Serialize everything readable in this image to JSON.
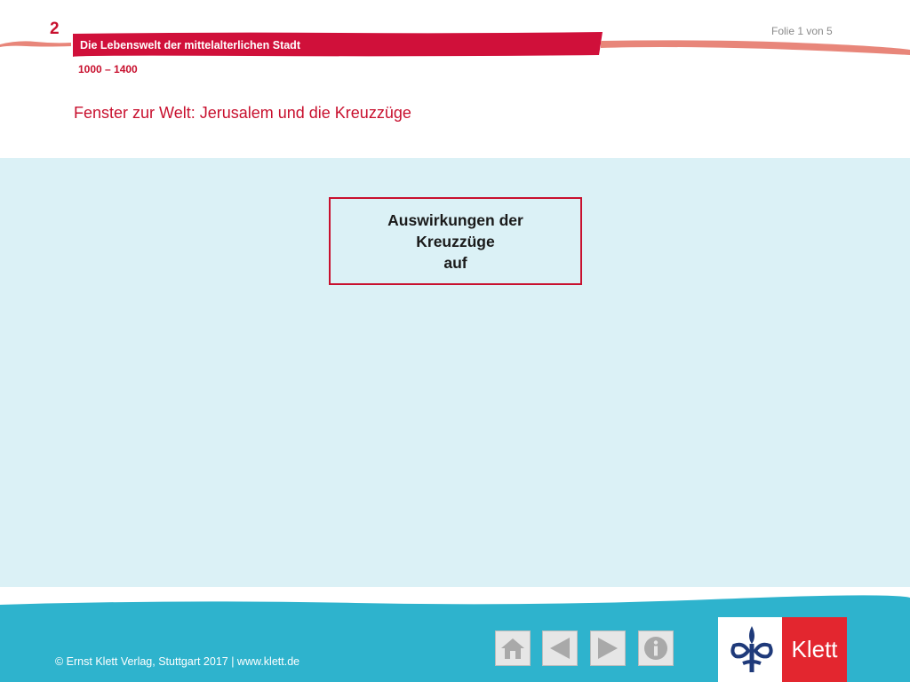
{
  "header": {
    "chapter_number": "2",
    "slide_counter": "Folie 1 von 5",
    "chapter_title": "Die Lebenswelt der mittelalterlichen Stadt",
    "date_range": "1000 – 1400",
    "slide_title": "Fenster zur Welt: Jerusalem und die Kreuzzüge"
  },
  "main": {
    "topic_box": {
      "lines": [
        "Auswirkungen der",
        "Kreuzzüge",
        "auf"
      ]
    }
  },
  "footer": {
    "copyright": "© Ernst Klett Verlag, Stuttgart 2017 | www.klett.de",
    "nav": [
      {
        "name": "home",
        "icon": "home-icon"
      },
      {
        "name": "previous",
        "icon": "arrow-left-icon"
      },
      {
        "name": "next",
        "icon": "arrow-right-icon"
      },
      {
        "name": "info",
        "icon": "info-icon"
      }
    ],
    "logo_text": "Klett"
  },
  "colors": {
    "accent_red": "#c8102e",
    "ribbon_light": "#e8867a",
    "content_bg": "#dbf1f6",
    "footer_bg": "#2eb3cd",
    "logo_red": "#e3262f"
  }
}
